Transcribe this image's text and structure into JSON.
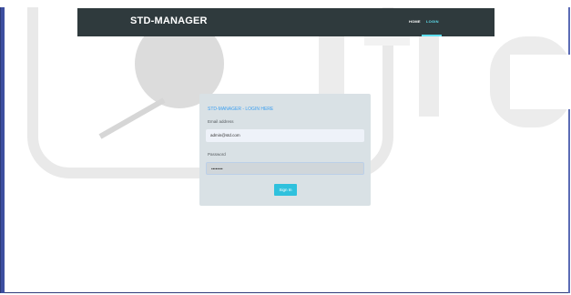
{
  "navbar": {
    "brand": "STD-MANAGER",
    "links": [
      {
        "label": "HOME"
      },
      {
        "label": "LOGIN"
      }
    ]
  },
  "login": {
    "title": "STD-MANAGER - LOGIN HERE",
    "email_label": "Email address",
    "email_value": "admin@std.com",
    "password_label": "Password",
    "password_value": "••••••••",
    "submit_label": "Sign In"
  },
  "colors": {
    "navbar_bg": "#2f3a3d",
    "accent": "#2fc1dd",
    "card_bg": "#d9e1e5",
    "title_blue": "#3b9ff0"
  }
}
